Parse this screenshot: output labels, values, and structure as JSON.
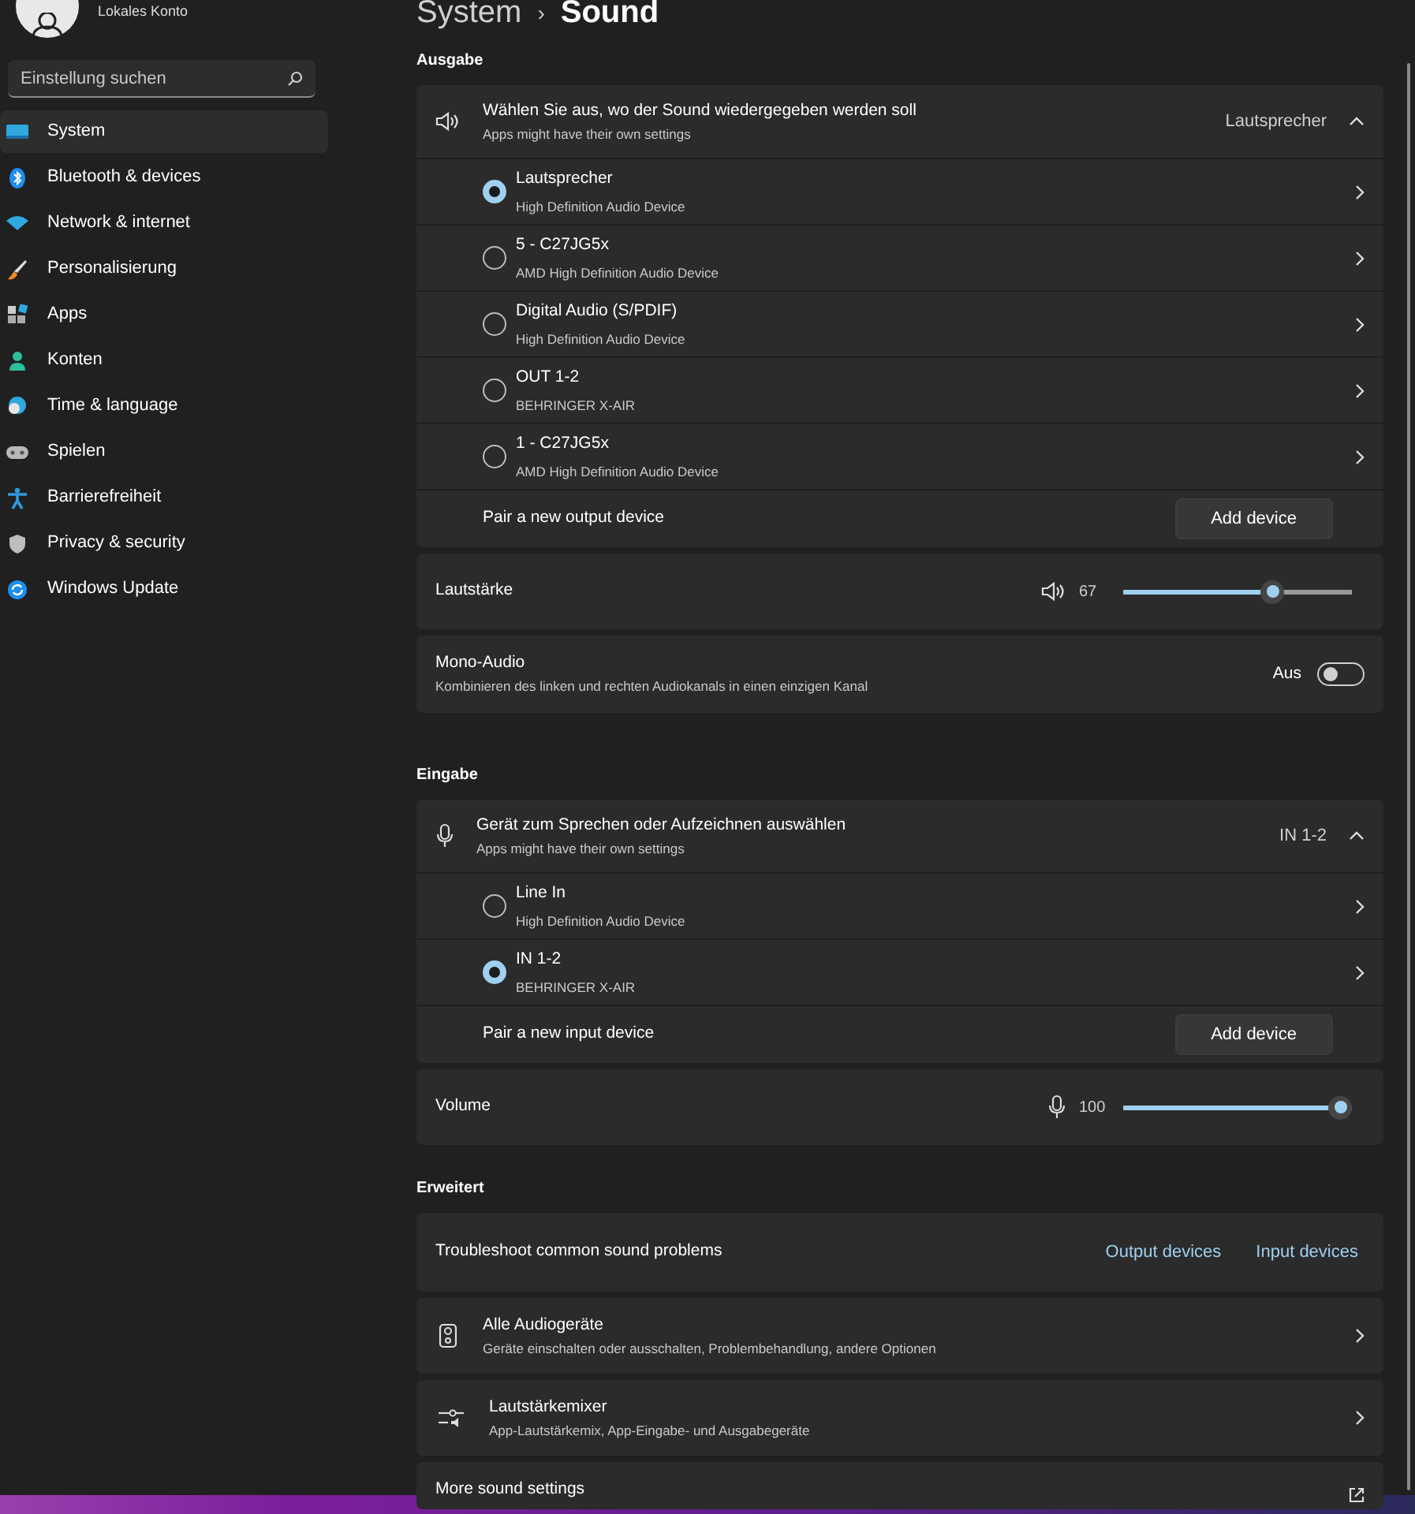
{
  "account": {
    "name": "Lokales Konto"
  },
  "search": {
    "placeholder": "Einstellung suchen"
  },
  "sidebar": {
    "items": [
      {
        "label": "System",
        "kind": "system",
        "selected": true
      },
      {
        "label": "Bluetooth & devices",
        "kind": "bluetooth",
        "selected": false
      },
      {
        "label": "Network & internet",
        "kind": "network",
        "selected": false
      },
      {
        "label": "Personalisierung",
        "kind": "brush",
        "selected": false
      },
      {
        "label": "Apps",
        "kind": "apps",
        "selected": false
      },
      {
        "label": "Konten",
        "kind": "person",
        "selected": false
      },
      {
        "label": "Time & language",
        "kind": "clock",
        "selected": false
      },
      {
        "label": "Spielen",
        "kind": "gamepad",
        "selected": false
      },
      {
        "label": "Barrierefreiheit",
        "kind": "accessibility",
        "selected": false
      },
      {
        "label": "Privacy & security",
        "kind": "shield",
        "selected": false
      },
      {
        "label": "Windows Update",
        "kind": "update",
        "selected": false
      }
    ]
  },
  "breadcrumb": {
    "parent": "System",
    "separator": "›",
    "current": "Sound"
  },
  "sections": [
    {
      "heading": "Ausgabe",
      "chooser": {
        "title": "Wählen Sie aus, wo der Sound wiedergegeben werden soll",
        "subtitle": "Apps might have their own settings",
        "value": "Lautsprecher",
        "expanded": true
      },
      "devices": [
        {
          "name": "Lautsprecher",
          "detail": "High Definition Audio Device",
          "selected": true
        },
        {
          "name": "5 - C27JG5x",
          "detail": "AMD High Definition Audio Device",
          "selected": false
        },
        {
          "name": "Digital Audio (S/PDIF)",
          "detail": "High Definition Audio Device",
          "selected": false
        },
        {
          "name": "OUT 1-2",
          "detail": "BEHRINGER X-AIR",
          "selected": false
        },
        {
          "name": "1 - C27JG5x",
          "detail": "AMD High Definition Audio Device",
          "selected": false
        }
      ],
      "pair": {
        "label": "Pair a new output device",
        "button": "Add device"
      },
      "volume": {
        "label": "Lautstärke",
        "reading": "67",
        "level": 0.67
      },
      "mono": {
        "title": "Mono-Audio",
        "subtitle": "Kombinieren des linken und rechten Audiokanals in einen einzigen Kanal",
        "state_label": "Aus",
        "on": false
      }
    },
    {
      "heading": "Eingabe",
      "chooser": {
        "title": "Gerät zum Sprechen oder Aufzeichnen auswählen",
        "subtitle": "Apps might have their own settings",
        "value": "IN 1-2",
        "expanded": true
      },
      "devices": [
        {
          "name": "Line In",
          "detail": "High Definition Audio Device",
          "selected": false
        },
        {
          "name": "IN 1-2",
          "detail": "BEHRINGER X-AIR",
          "selected": true
        }
      ],
      "pair": {
        "label": "Pair a new input device",
        "button": "Add device"
      },
      "volume": {
        "label": "Volume",
        "reading": "100",
        "level": 1.0
      }
    }
  ],
  "advanced": {
    "heading": "Erweitert",
    "troubleshoot": {
      "label": "Troubleshoot common sound problems",
      "links": [
        "Output devices",
        "Input devices"
      ]
    },
    "items": [
      {
        "kind": "audio-device",
        "title": "Alle Audiogeräte",
        "subtitle": "Geräte einschalten oder ausschalten, Problembehandlung, andere Optionen"
      },
      {
        "kind": "mixer",
        "title": "Lautstärkemixer",
        "subtitle": "App-Lautstärkemix, App-Eingabe- und Ausgabegeräte"
      }
    ],
    "more": {
      "label": "More sound settings"
    }
  }
}
